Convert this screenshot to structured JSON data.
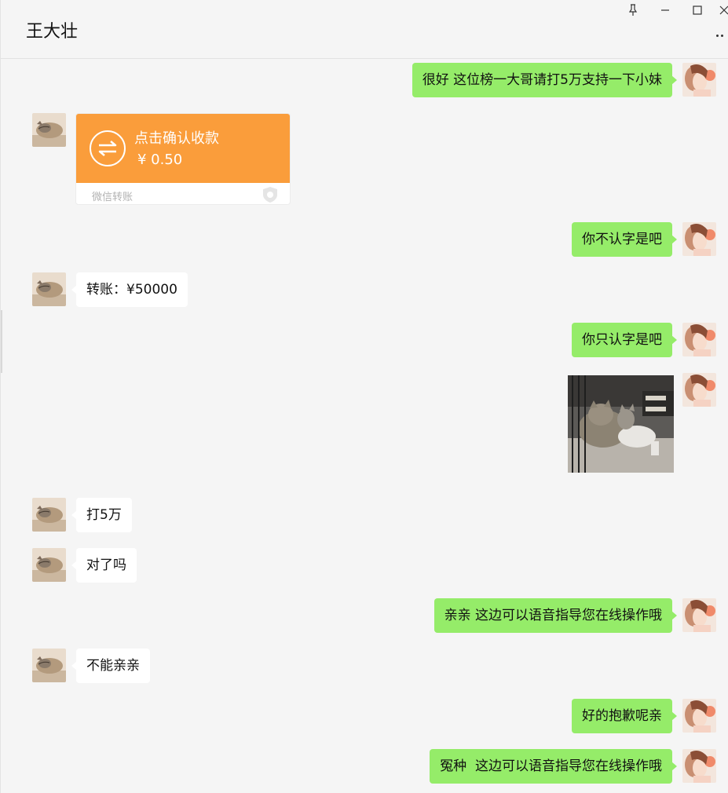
{
  "window": {
    "title": "王大壮",
    "pin_icon": "pin-icon",
    "minimize_icon": "minimize-icon",
    "maximize_icon": "maximize-icon",
    "close_icon": "close-icon",
    "more_icon": "more-icon"
  },
  "messages": [
    {
      "sender": "me",
      "type": "text",
      "text": "很好 这位榜一大哥请打5万支持一下小妹"
    },
    {
      "sender": "them",
      "type": "transfer",
      "title": "点击确认收款",
      "amount": "¥ 0.50",
      "footer": "微信转账",
      "icon": "transfer-arrows-icon"
    },
    {
      "sender": "me",
      "type": "text",
      "text": "你不认字是吧"
    },
    {
      "sender": "them",
      "type": "text",
      "text": "转账：¥50000"
    },
    {
      "sender": "me",
      "type": "text",
      "text": "你只认字是吧"
    },
    {
      "sender": "me",
      "type": "image",
      "subject": "two-cats-photo"
    },
    {
      "sender": "them",
      "type": "text",
      "text": "打5万"
    },
    {
      "sender": "them",
      "type": "text",
      "text": "对了吗"
    },
    {
      "sender": "me",
      "type": "text",
      "text": "亲亲 这边可以语音指导您在线操作哦"
    },
    {
      "sender": "them",
      "type": "text",
      "text": "不能亲亲"
    },
    {
      "sender": "me",
      "type": "text",
      "text": "好的抱歉呢亲"
    },
    {
      "sender": "me",
      "type": "text",
      "text": "冤种  这边可以语音指导您在线操作哦"
    }
  ],
  "colors": {
    "me_bubble": "#95ec69",
    "them_bubble": "#ffffff",
    "transfer_orange": "#fa9d3b",
    "background": "#f5f5f5"
  }
}
